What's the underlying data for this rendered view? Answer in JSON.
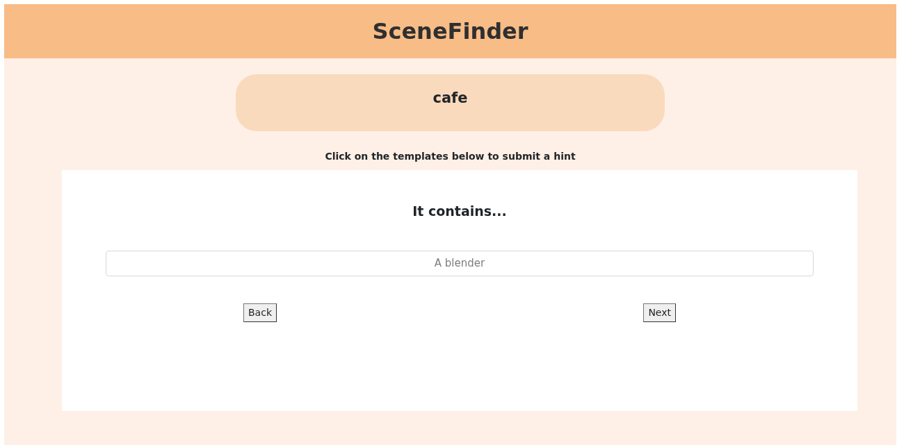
{
  "header": {
    "title": "SceneFinder"
  },
  "word": "cafe",
  "instruction": "Click on the templates below to submit a hint",
  "template": {
    "heading": "It contains...",
    "field": {
      "placeholder": "A blender"
    }
  },
  "buttons": [
    {
      "label": "Back"
    },
    {
      "label": "Next"
    }
  ]
}
